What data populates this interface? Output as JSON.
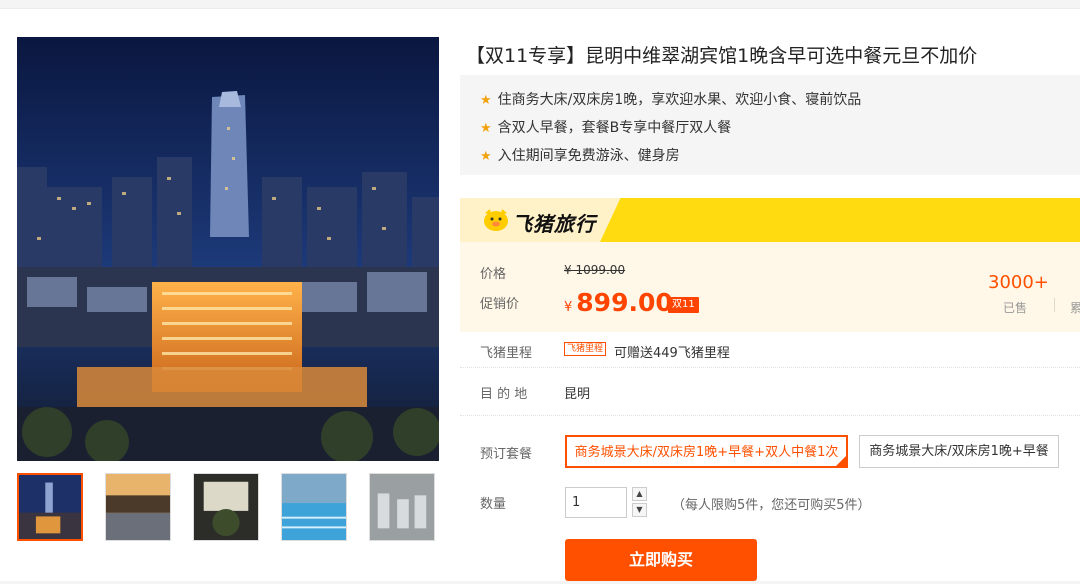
{
  "product": {
    "title": "【双11专享】昆明中维翠湖宾馆1晚含早可选中餐元旦不加价",
    "features": [
      "住商务大床/双床房1晚，享欢迎水果、欢迎小食、寝前饮品",
      "含双人早餐，套餐B专享中餐厅双人餐",
      "入住期间享免费游泳、健身房"
    ]
  },
  "brand": {
    "name": "飞猪旅行",
    "accent": "#ffdb10"
  },
  "price": {
    "label": "价格",
    "original": "¥ 1099.00",
    "promo_label": "促销价",
    "currency": "¥",
    "promo_value": "899.00",
    "promo_tag": "双11",
    "sold_count": "3000+",
    "sold_label": "已售",
    "cumulative_label": "累"
  },
  "miles": {
    "label": "飞猪里程",
    "tag": "飞猪里程",
    "text": "可赠送449飞猪里程"
  },
  "destination": {
    "label": "目 的 地",
    "value": "昆明"
  },
  "package": {
    "label": "预订套餐",
    "options": [
      "商务城景大床/双床房1晚+早餐+双人中餐1次",
      "商务城景大床/双床房1晚+早餐"
    ],
    "selected_index": 0
  },
  "quantity": {
    "label": "数量",
    "value": "1",
    "note": "（每人限购5件，您还可购买5件）"
  },
  "buy_button": "立即购买",
  "gallery": {
    "thumbnail_count": 5,
    "active_index": 0
  },
  "colors": {
    "primary": "#ff5000",
    "feature_bg": "#f5f5f5",
    "price_bg": "#fff7e8"
  }
}
